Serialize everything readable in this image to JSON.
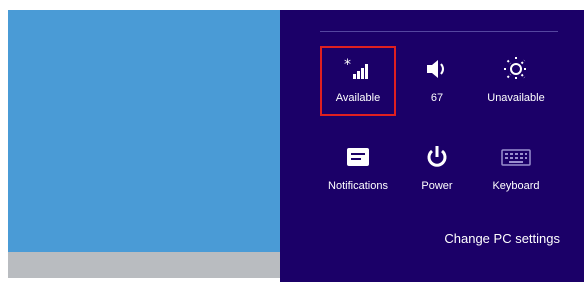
{
  "settings": {
    "tiles": [
      {
        "label": "Available",
        "icon": "wifi-signal-icon"
      },
      {
        "label": "67",
        "icon": "volume-icon"
      },
      {
        "label": "Unavailable",
        "icon": "brightness-icon"
      },
      {
        "label": "Notifications",
        "icon": "notifications-icon"
      },
      {
        "label": "Power",
        "icon": "power-icon"
      },
      {
        "label": "Keyboard",
        "icon": "keyboard-icon"
      }
    ],
    "change_pc_settings": "Change PC settings"
  },
  "colors": {
    "charms_background": "#1b0068",
    "desktop_background": "#4a9bd6",
    "highlight": "#e02020"
  }
}
